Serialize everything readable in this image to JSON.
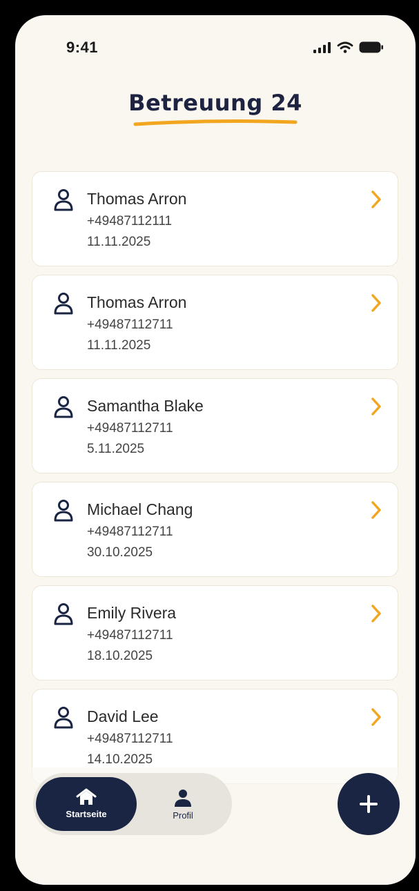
{
  "status_bar": {
    "time": "9:41",
    "icons": [
      "cellular-signal-icon",
      "wifi-icon",
      "battery-icon"
    ]
  },
  "header": {
    "logo_text": "Betreuung 24"
  },
  "colors": {
    "navy": "#1a2544",
    "accent_orange": "#f2a51f",
    "background": "#faf7f0",
    "card": "#ffffff"
  },
  "contacts": [
    {
      "name": "Thomas Arron",
      "phone": "+49487112111",
      "date": "11.11.2025"
    },
    {
      "name": "Thomas Arron",
      "phone": "+49487112711",
      "date": "11.11.2025"
    },
    {
      "name": "Samantha Blake",
      "phone": "+49487112711",
      "date": "5.11.2025"
    },
    {
      "name": "Michael Chang",
      "phone": "+49487112711",
      "date": "30.10.2025"
    },
    {
      "name": "Emily Rivera",
      "phone": "+49487112711",
      "date": "18.10.2025"
    },
    {
      "name": "David Lee",
      "phone": "+49487112711",
      "date": "14.10.2025"
    }
  ],
  "nav": {
    "home_label": "Startseite",
    "profile_label": "Profil",
    "active": "Startseite"
  },
  "fab": {
    "icon": "plus-icon"
  }
}
